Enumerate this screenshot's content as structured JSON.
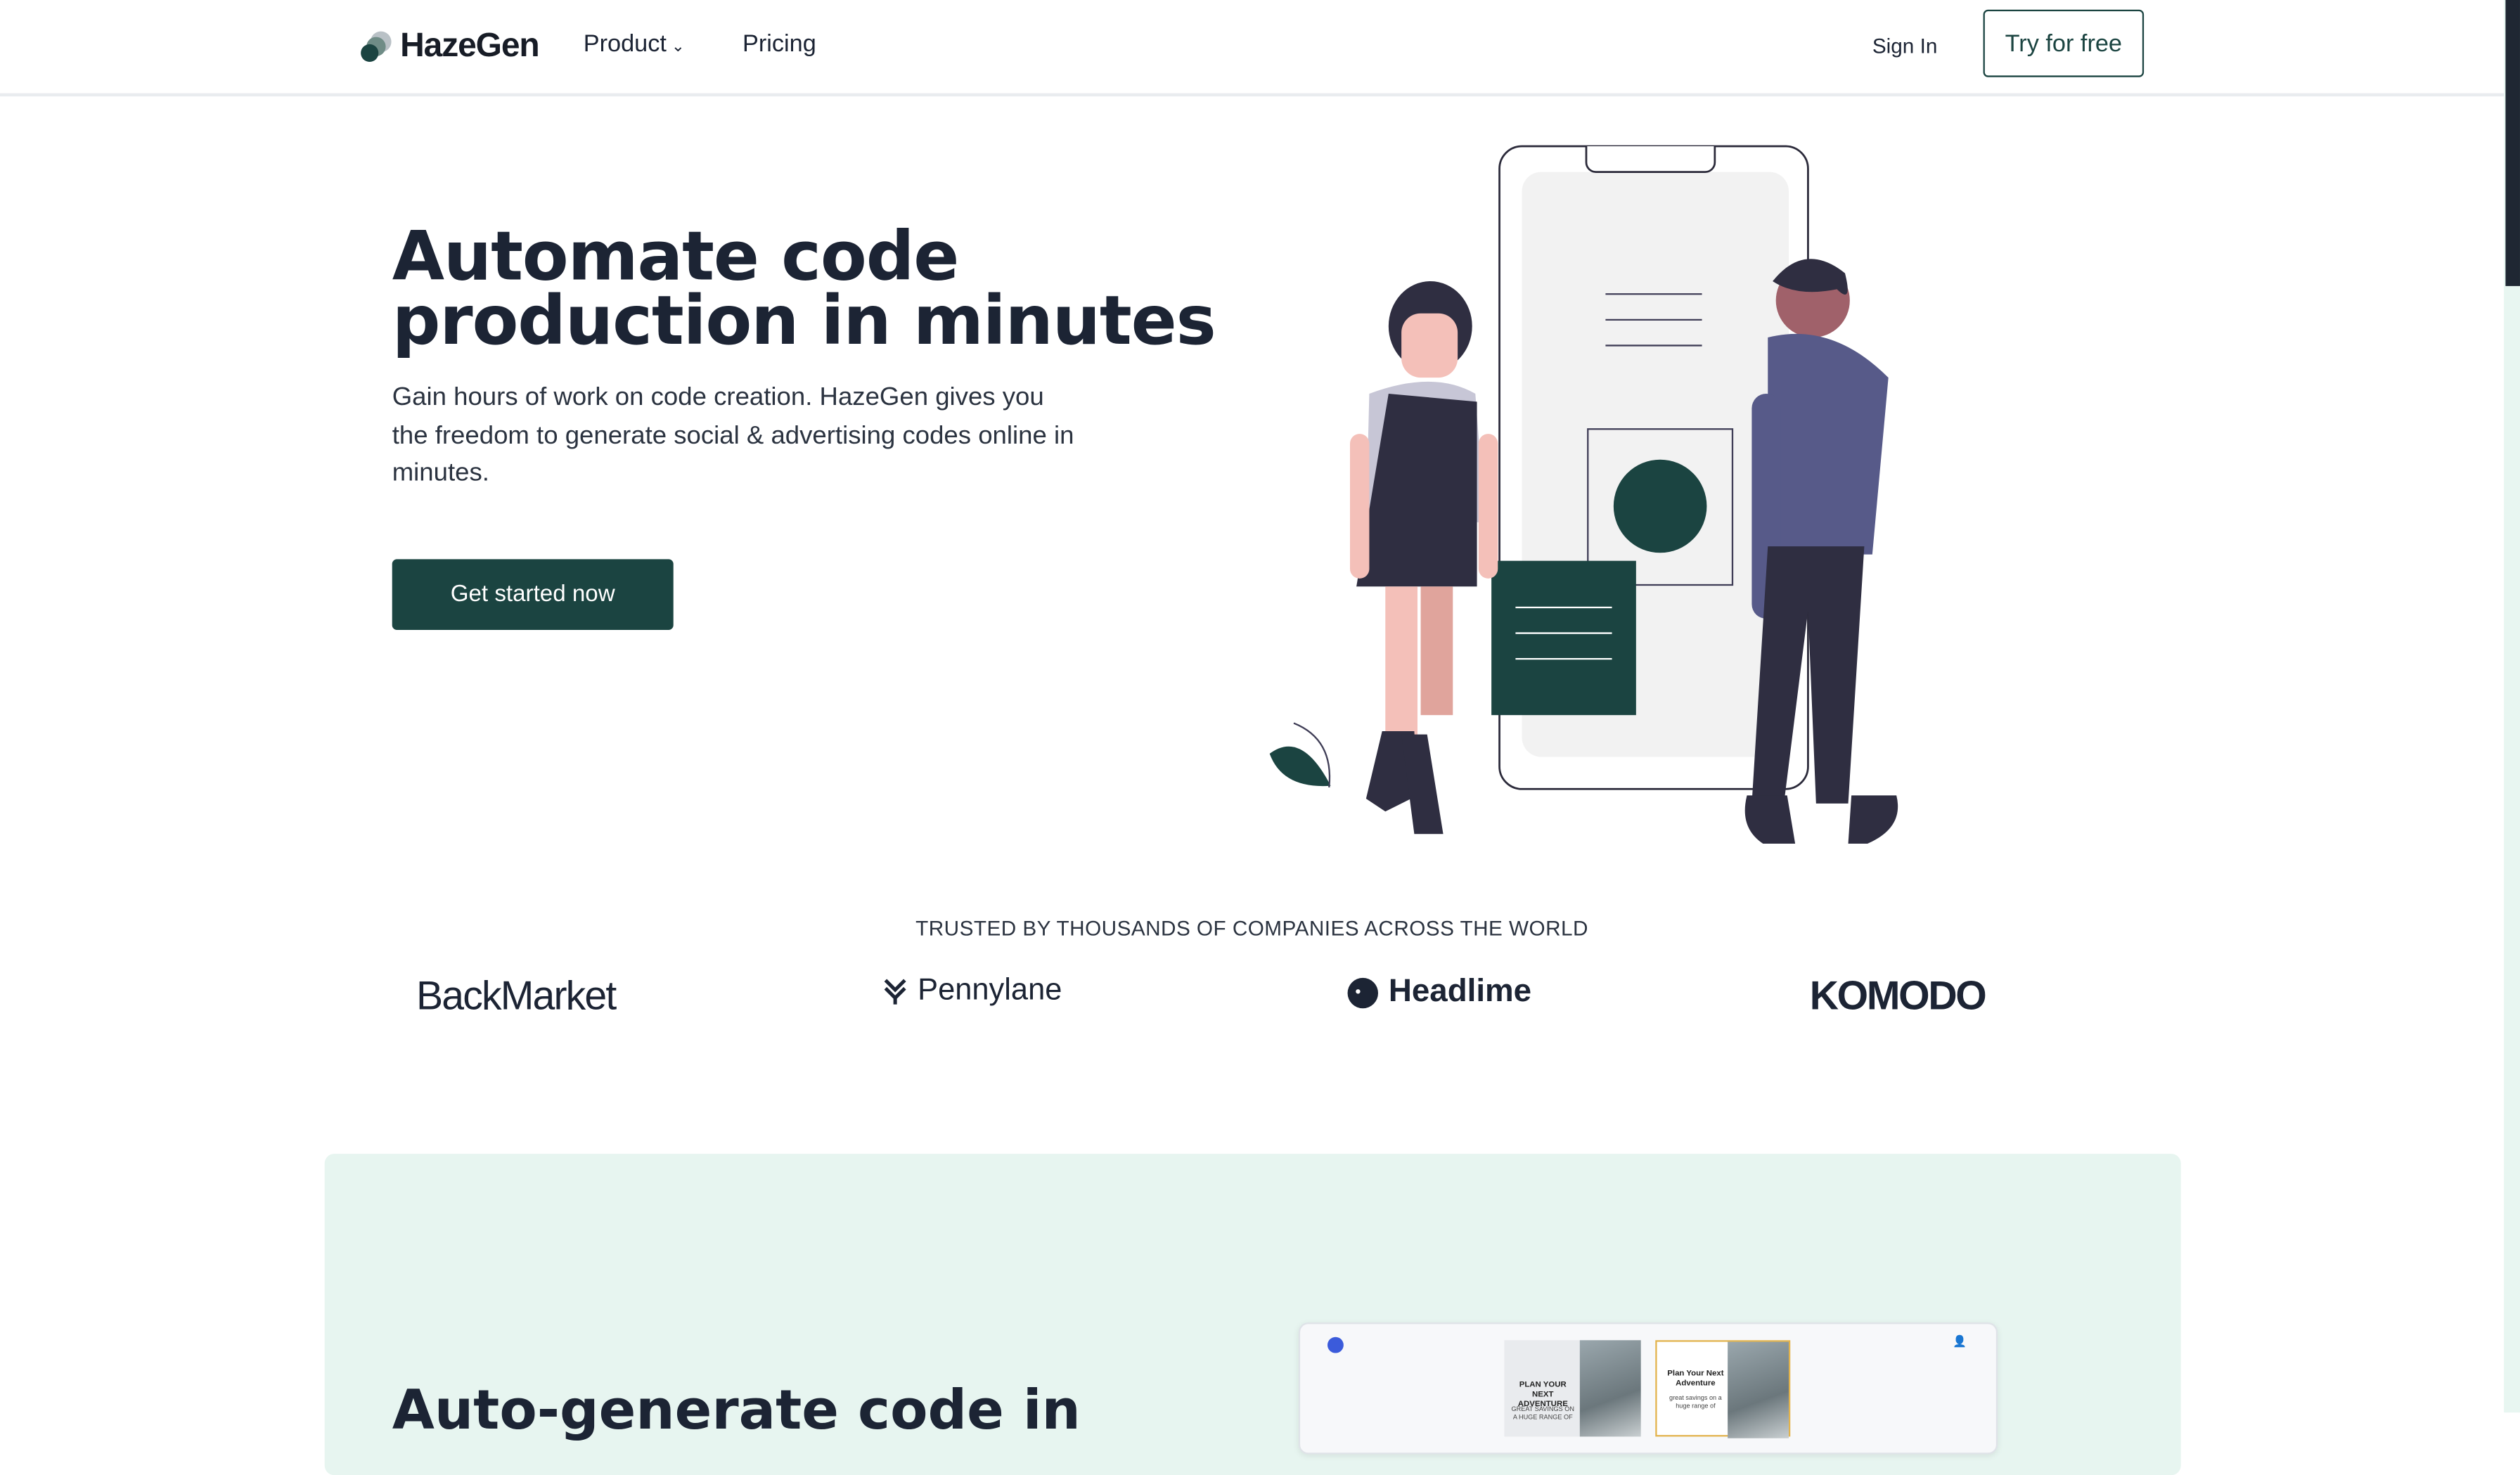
{
  "header": {
    "brand": "HazeGen",
    "nav": {
      "product": "Product",
      "pricing": "Pricing"
    },
    "sign_in": "Sign In",
    "try_free": "Try for free"
  },
  "hero": {
    "title": "Automate code production in minutes",
    "subtitle": "Gain hours of work on code creation. HazeGen gives you the freedom to generate social & advertising codes online in minutes.",
    "cta": "Get started now"
  },
  "trusted": {
    "heading": "TRUSTED BY THOUSANDS OF COMPANIES ACROSS THE WORLD",
    "brands": [
      "BackMarket",
      "Pennylane",
      "Headlime",
      "KOMODO"
    ]
  },
  "feature": {
    "title": "Auto-generate code in",
    "preview": {
      "card1_title": "PLAN YOUR NEXT ADVENTURE",
      "card1_sub": "GREAT SAVINGS ON A HUGE RANGE OF",
      "card2_title": "Plan Your Next Adventure",
      "card2_sub": "great savings on a huge range of"
    }
  },
  "colors": {
    "primary": "#1b4441",
    "text": "#1c2434",
    "feature_bg": "#e7f5f0",
    "accent": "#e2b34c"
  }
}
